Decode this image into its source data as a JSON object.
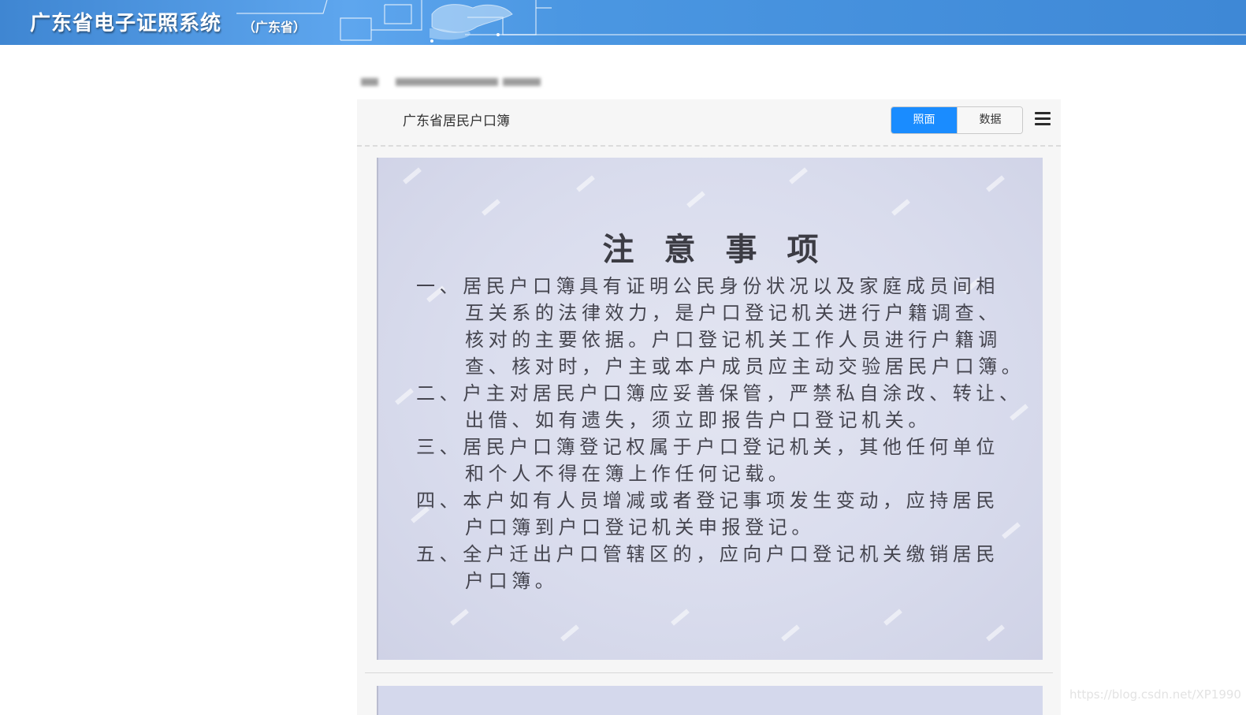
{
  "header": {
    "title": "广东省电子证照系统",
    "subtitle": "（广东省）"
  },
  "document": {
    "title": "广东省居民户口簿",
    "view_tabs": [
      {
        "label": "照面",
        "active": true
      },
      {
        "label": "数据",
        "active": false
      }
    ],
    "menu_icon": "hamburger-menu-icon"
  },
  "scan": {
    "heading": "注意事项",
    "items": [
      {
        "lines": [
          "一、居民户口簿具有证明公民身份状况以及家庭成员间相",
          "互关系的法律效力，是户口登记机关进行户籍调查、",
          "核对的主要依据。户口登记机关工作人员进行户籍调",
          "查、核对时，户主或本户成员应主动交验居民户口簿。"
        ]
      },
      {
        "lines": [
          "二、户主对居民户口簿应妥善保管，严禁私自涂改、转让、",
          "出借、如有遗失，须立即报告户口登记机关。"
        ]
      },
      {
        "lines": [
          "三、居民户口簿登记权属于户口登记机关，其他任何单位",
          "和个人不得在簿上作任何记载。"
        ]
      },
      {
        "lines": [
          "四、本户如有人员增减或者登记事项发生变动，应持居民",
          "户口簿到户口登记机关申报登记。"
        ]
      },
      {
        "lines": [
          "五、全户迁出户口管辖区的，应向户口登记机关缴销居民",
          "户口簿。"
        ]
      }
    ]
  },
  "footer": {
    "watermark": "https://blog.csdn.net/XP1990"
  },
  "colors": {
    "banner": "#4b97e2",
    "active_tab": "#1a8cff",
    "scan_paper": "#d9dced"
  }
}
